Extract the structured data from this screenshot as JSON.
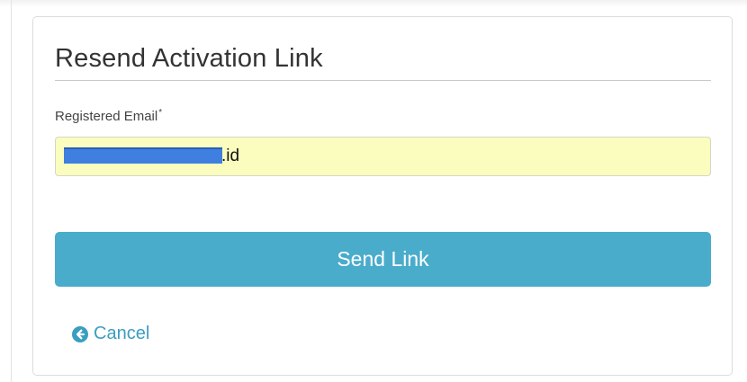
{
  "form": {
    "title": "Resend Activation Link",
    "email_label": "Registered Email",
    "required_marker": "*",
    "email_value_visible_suffix": ".id",
    "send_button_label": "Send Link",
    "cancel_label": "Cancel"
  },
  "colors": {
    "accent": "#4aaccb",
    "link": "#3a9ec0",
    "input_autofill_bg": "#fafdbe",
    "redaction": "#3f7fe0"
  },
  "icons": {
    "cancel": "circle-arrow-left-icon"
  }
}
